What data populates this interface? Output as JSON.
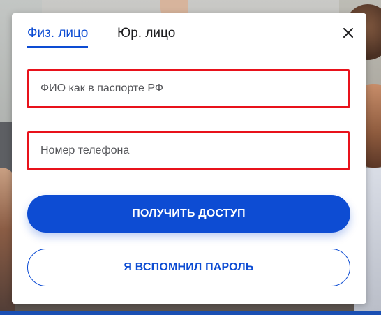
{
  "tabs": {
    "individual_label": "Физ. лицо",
    "legal_label": "Юр. лицо",
    "active": "individual"
  },
  "form": {
    "fio_placeholder": "ФИО как в паспорте РФ",
    "fio_value": "",
    "phone_placeholder": "Номер телефона",
    "phone_value": ""
  },
  "buttons": {
    "get_access_label": "ПОЛУЧИТЬ ДОСТУП",
    "remember_password_label": "Я ВСПОМНИЛ ПАРОЛЬ"
  },
  "icons": {
    "close": "close-icon"
  },
  "colors": {
    "accent": "#0d4cd3",
    "error_border": "#e8121b"
  }
}
